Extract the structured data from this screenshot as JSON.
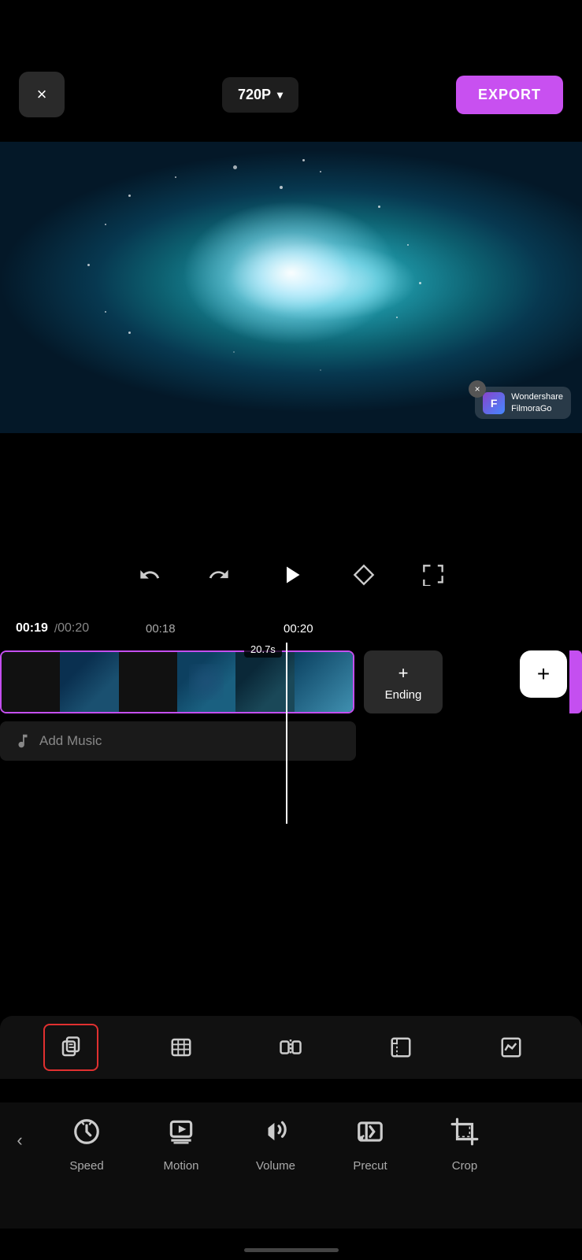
{
  "topbar": {
    "close_label": "×",
    "quality_label": "720P",
    "quality_arrow": "▾",
    "export_label": "EXPORT"
  },
  "watermark": {
    "brand_line1": "Wondershare",
    "brand_line2": "FilmoraGo",
    "close": "×"
  },
  "controls": {
    "undo": "↩",
    "redo": "↪",
    "play": "▶",
    "keyframe": "◇",
    "fullscreen": "⛶"
  },
  "timeline": {
    "current_time": "00:19",
    "separator": "/",
    "total_time": "00:20",
    "mark1": "00:18",
    "mark2": "00:20",
    "duration_badge": "20.7s"
  },
  "track": {
    "ending_plus": "+",
    "ending_label": "Ending",
    "add_plus": "+"
  },
  "add_music": {
    "label": "Add Music"
  },
  "tool_icons": [
    {
      "id": "copy",
      "symbol": "⧉",
      "selected": true
    },
    {
      "id": "trim",
      "symbol": "⌗",
      "selected": false
    },
    {
      "id": "split",
      "symbol": "⏸",
      "selected": false
    },
    {
      "id": "corner",
      "symbol": "⌐",
      "selected": false
    },
    {
      "id": "chart",
      "symbol": "⬚",
      "selected": false
    }
  ],
  "bottom_nav": {
    "back": "‹",
    "items": [
      {
        "id": "speed",
        "icon": "speed",
        "label": "Speed"
      },
      {
        "id": "motion",
        "icon": "motion",
        "label": "Motion"
      },
      {
        "id": "volume",
        "icon": "volume",
        "label": "Volume"
      },
      {
        "id": "precut",
        "icon": "precut",
        "label": "Precut"
      },
      {
        "id": "crop",
        "icon": "crop",
        "label": "Crop"
      }
    ]
  }
}
